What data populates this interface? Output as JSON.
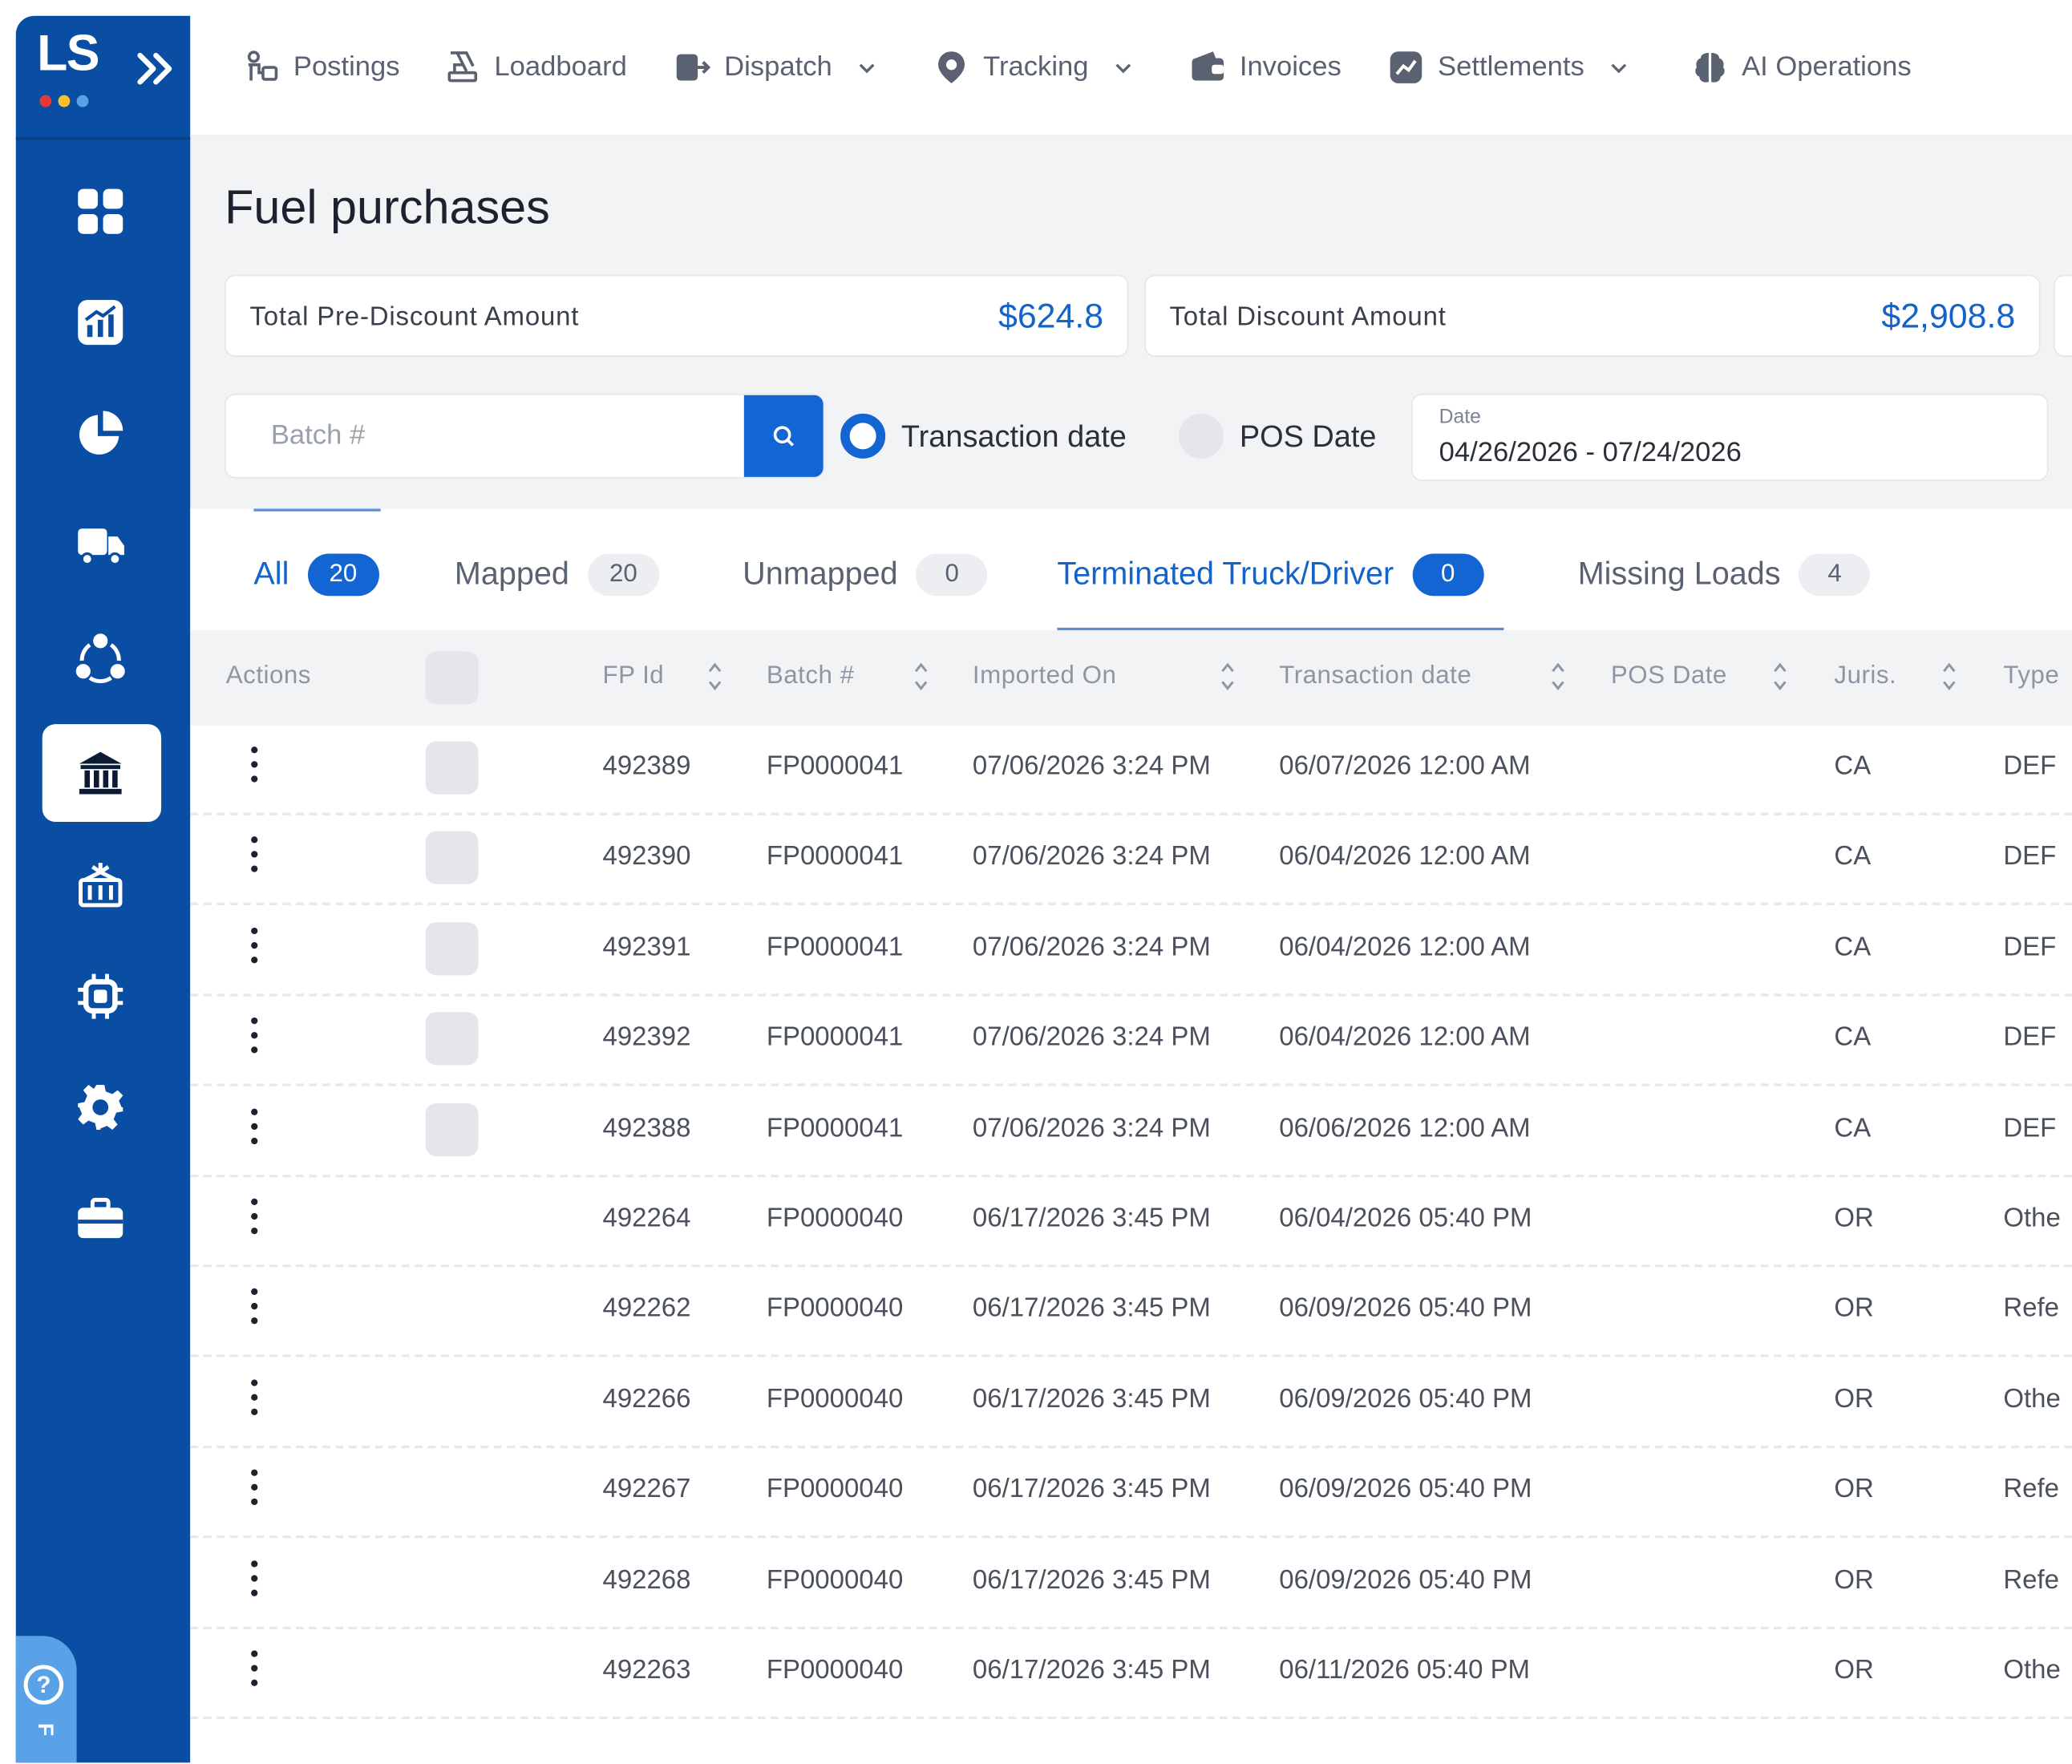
{
  "app": {
    "logo_text": "LS",
    "logo_dot_colors": [
      "#e53935",
      "#fbc02d",
      "#5aa2e8"
    ]
  },
  "topnav": {
    "items": [
      {
        "label": "Postings",
        "icon": "postings-icon",
        "has_dropdown": false
      },
      {
        "label": "Loadboard",
        "icon": "loadboard-icon",
        "has_dropdown": false
      },
      {
        "label": "Dispatch",
        "icon": "dispatch-icon",
        "has_dropdown": true
      },
      {
        "label": "Tracking",
        "icon": "location-pin-icon",
        "has_dropdown": true
      },
      {
        "label": "Invoices",
        "icon": "wallet-icon",
        "has_dropdown": false
      },
      {
        "label": "Settlements",
        "icon": "chart-trend-icon",
        "has_dropdown": true
      },
      {
        "label": "AI Operations",
        "icon": "brain-icon",
        "has_dropdown": false
      }
    ]
  },
  "sidebar": {
    "items": [
      {
        "icon": "dashboard-grid-icon",
        "active": false
      },
      {
        "icon": "bar-chart-icon",
        "active": false
      },
      {
        "icon": "pie-chart-icon",
        "active": false
      },
      {
        "icon": "truck-icon",
        "active": false
      },
      {
        "icon": "network-cycle-icon",
        "active": false
      },
      {
        "icon": "bank-icon",
        "active": true
      },
      {
        "icon": "container-icon",
        "active": false
      },
      {
        "icon": "chip-icon",
        "active": false
      },
      {
        "icon": "gear-icon",
        "active": false
      },
      {
        "icon": "briefcase-icon",
        "active": false
      }
    ],
    "help_label": "F"
  },
  "page": {
    "title": "Fuel purchases"
  },
  "stats": [
    {
      "label": "Total Pre-Discount Amount",
      "value": "$624.8"
    },
    {
      "label": "Total Discount Amount",
      "value": "$2,908.8"
    }
  ],
  "filters": {
    "batch_placeholder": "Batch #",
    "radio_transaction": "Transaction date",
    "radio_pos": "POS Date",
    "selected_radio": "Transaction date",
    "date_label": "Date",
    "date_value": "04/26/2026 - 07/24/2026"
  },
  "tabs": [
    {
      "label": "All",
      "count": "20",
      "active": true
    },
    {
      "label": "Mapped",
      "count": "20",
      "active": false
    },
    {
      "label": "Unmapped",
      "count": "0",
      "active": false
    },
    {
      "label": "Terminated Truck/Driver",
      "count": "0",
      "active": true
    },
    {
      "label": "Missing Loads",
      "count": "4",
      "active": false
    }
  ],
  "table": {
    "columns": [
      "Actions",
      "FP Id",
      "Batch #",
      "Imported On",
      "Transaction date",
      "POS Date",
      "Juris.",
      "Type"
    ],
    "rows": [
      {
        "fp_id": "492389",
        "batch": "FP0000041",
        "imported_on": "07/06/2026 3:24 PM",
        "transaction_date": "06/07/2026 12:00 AM",
        "pos_date": "",
        "juris": "CA",
        "type": "DEF",
        "has_checkbox": true
      },
      {
        "fp_id": "492390",
        "batch": "FP0000041",
        "imported_on": "07/06/2026 3:24 PM",
        "transaction_date": "06/04/2026 12:00 AM",
        "pos_date": "",
        "juris": "CA",
        "type": "DEF",
        "has_checkbox": true
      },
      {
        "fp_id": "492391",
        "batch": "FP0000041",
        "imported_on": "07/06/2026 3:24 PM",
        "transaction_date": "06/04/2026 12:00 AM",
        "pos_date": "",
        "juris": "CA",
        "type": "DEF",
        "has_checkbox": true
      },
      {
        "fp_id": "492392",
        "batch": "FP0000041",
        "imported_on": "07/06/2026 3:24 PM",
        "transaction_date": "06/04/2026 12:00 AM",
        "pos_date": "",
        "juris": "CA",
        "type": "DEF",
        "has_checkbox": true
      },
      {
        "fp_id": "492388",
        "batch": "FP0000041",
        "imported_on": "07/06/2026 3:24 PM",
        "transaction_date": "06/06/2026 12:00 AM",
        "pos_date": "",
        "juris": "CA",
        "type": "DEF",
        "has_checkbox": true
      },
      {
        "fp_id": "492264",
        "batch": "FP0000040",
        "imported_on": "06/17/2026 3:45 PM",
        "transaction_date": "06/04/2026 05:40 PM",
        "pos_date": "",
        "juris": "OR",
        "type": "Othe",
        "has_checkbox": false
      },
      {
        "fp_id": "492262",
        "batch": "FP0000040",
        "imported_on": "06/17/2026 3:45 PM",
        "transaction_date": "06/09/2026 05:40 PM",
        "pos_date": "",
        "juris": "OR",
        "type": "Refe",
        "has_checkbox": false
      },
      {
        "fp_id": "492266",
        "batch": "FP0000040",
        "imported_on": "06/17/2026 3:45 PM",
        "transaction_date": "06/09/2026 05:40 PM",
        "pos_date": "",
        "juris": "OR",
        "type": "Othe",
        "has_checkbox": false
      },
      {
        "fp_id": "492267",
        "batch": "FP0000040",
        "imported_on": "06/17/2026 3:45 PM",
        "transaction_date": "06/09/2026 05:40 PM",
        "pos_date": "",
        "juris": "OR",
        "type": "Refe",
        "has_checkbox": false
      },
      {
        "fp_id": "492268",
        "batch": "FP0000040",
        "imported_on": "06/17/2026 3:45 PM",
        "transaction_date": "06/09/2026 05:40 PM",
        "pos_date": "",
        "juris": "OR",
        "type": "Refe",
        "has_checkbox": false
      },
      {
        "fp_id": "492263",
        "batch": "FP0000040",
        "imported_on": "06/17/2026 3:45 PM",
        "transaction_date": "06/11/2026 05:40 PM",
        "pos_date": "",
        "juris": "OR",
        "type": "Othe",
        "has_checkbox": false
      }
    ]
  },
  "colors": {
    "brand": "#0a4ea3",
    "accent": "#1265d3",
    "value_text": "#1463c9"
  }
}
